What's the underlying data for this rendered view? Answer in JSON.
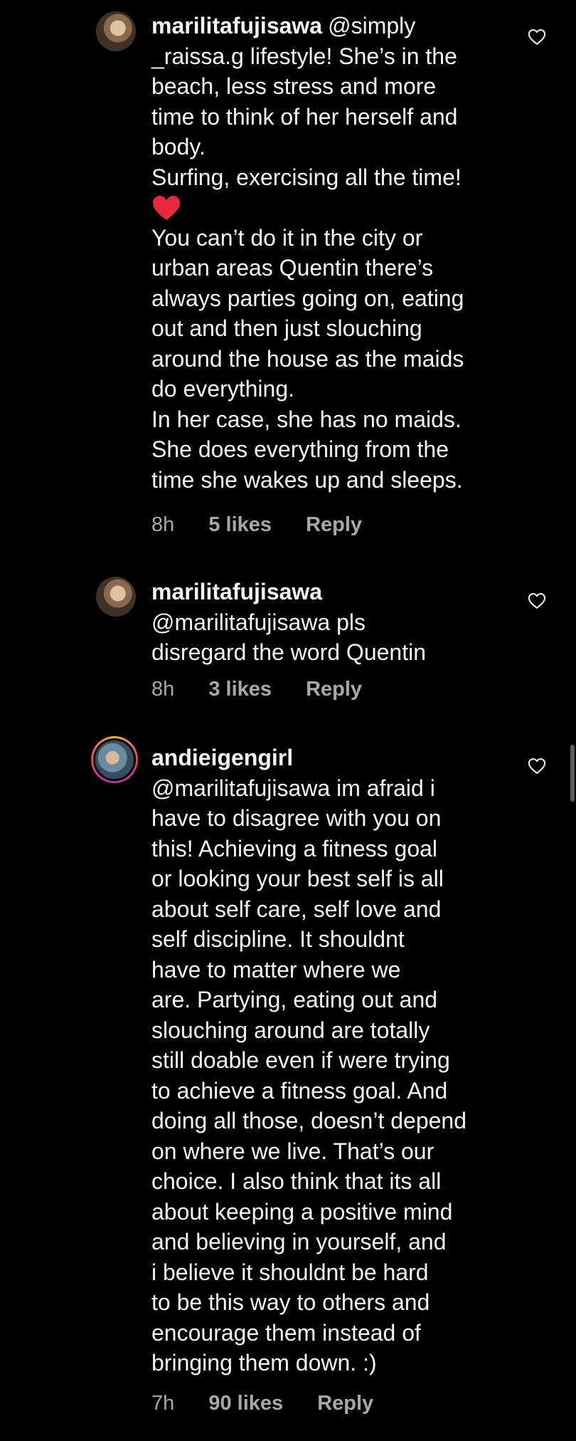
{
  "comments": [
    {
      "username": "marilitafujisawa",
      "lines": [
        "@simply",
        "_raissa.g lifestyle! She’s in the",
        "beach, less stress and more",
        "time to think of her herself and",
        "body.",
        "Surfing, exercising all the time!",
        "",
        "You can’t do it in the city or",
        "urban areas Quentin there’s",
        "always parties going on, eating",
        "out and then just slouching",
        "around the house as the maids",
        "do everything.",
        "In her case, she has no maids.",
        "She does everything from the",
        "time she wakes up and sleeps."
      ],
      "time": "8h",
      "likes": "5 likes",
      "reply": "Reply"
    },
    {
      "username": "marilitafujisawa",
      "lines": [
        "",
        "@marilitafujisawa pls",
        "disregard the word Quentin"
      ],
      "time": "8h",
      "likes": "3 likes",
      "reply": "Reply"
    },
    {
      "username": "andieigengirl",
      "lines": [
        "",
        "@marilitafujisawa im afraid i",
        "have to disagree with you on",
        "this! Achieving a fitness goal",
        "or looking your best self is all",
        "about self care, self love and",
        "self discipline. It shouldnt",
        "have to matter where we",
        "are. Partying, eating out and",
        "slouching around are totally",
        "still doable even if were trying",
        "to achieve a fitness goal. And",
        "doing all those, doesn’t depend",
        "on where we live. That’s our",
        "choice. I also think that its all",
        "about keeping a positive mind",
        "and believing in yourself, and",
        "i believe it shouldnt be hard",
        "to be this way to others and",
        "encourage them instead of",
        "bringing them down. :)"
      ],
      "time": "7h",
      "likes": "90 likes",
      "reply": "Reply"
    }
  ],
  "icons": {
    "like": "heart-outline-icon",
    "emoji": "red-heart-emoji"
  },
  "colors": {
    "background": "#000000",
    "text": "#f5f5f5",
    "meta": "#a8a8a8",
    "heart_emoji": "#e8283c"
  }
}
